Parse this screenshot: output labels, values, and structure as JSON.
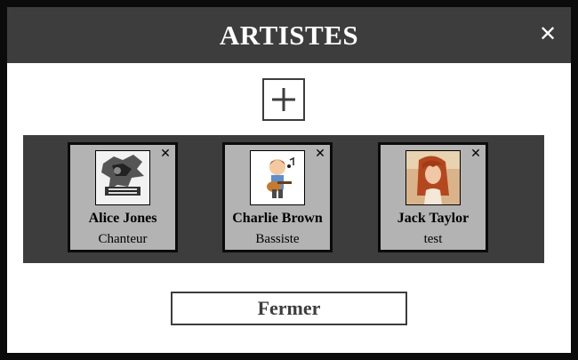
{
  "modal": {
    "title": "ARTISTES",
    "close_icon": "close-icon",
    "add_icon": "plus-icon",
    "close_button_label": "Fermer"
  },
  "artists": [
    {
      "name": "Alice Jones",
      "role": "Chanteur",
      "photo": "photo-guitarist-poster"
    },
    {
      "name": "Charlie Brown",
      "role": "Bassiste",
      "photo": "photo-cartoon-boy-guitar"
    },
    {
      "name": "Jack Taylor",
      "role": "test",
      "photo": "photo-red-haired-woman"
    }
  ],
  "colors": {
    "header_bg": "#3d3d3d",
    "card_bg": "#b3b3b3",
    "border": "#0b0b0b"
  }
}
